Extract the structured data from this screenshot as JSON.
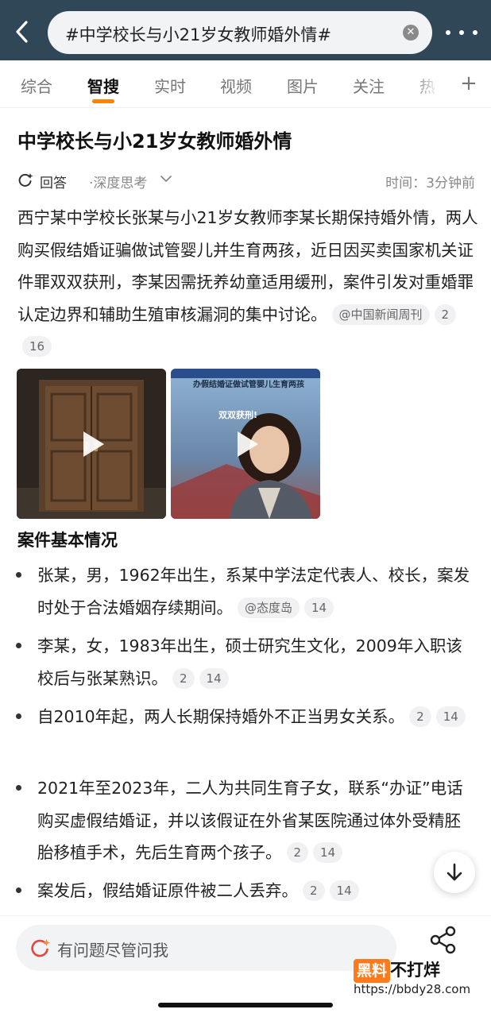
{
  "search": {
    "query": "#中学校长与小21岁女教师婚外情#",
    "clear_icon": "clear-icon",
    "back_icon": "chevron-left-icon",
    "more_icon": "more-horizontal-icon"
  },
  "tabs": [
    {
      "label": "综合",
      "active": false
    },
    {
      "label": "智搜",
      "active": true
    },
    {
      "label": "实时",
      "active": false
    },
    {
      "label": "视频",
      "active": false
    },
    {
      "label": "图片",
      "active": false
    },
    {
      "label": "关注",
      "active": false
    },
    {
      "label": "热",
      "active": false
    }
  ],
  "tab_plus": "+",
  "article": {
    "title": "中学校长与小21岁女教师婚外情",
    "answer_label": "回答",
    "deep_think_label": "·深度思考",
    "time_label": "时间：3分钟前",
    "summary": "西宁某中学校长张某与小21岁女教师李某长期保持婚外情，两人购买假结婚证骗做试管婴儿并生育两孩，近日因买卖国家机关证件罪双双获刑，李某因需抚养幼童适用缓刑，案件引发对重婚罪认定边界和辅助生殖审核漏洞的集中讨论。",
    "summary_source": "@中国新闻周刊",
    "summary_chips": [
      "2",
      "16"
    ],
    "media": [
      {
        "name": "video-door",
        "play_icon": "play-icon"
      },
      {
        "name": "video-woman",
        "overlay_text_1": "办假结婚证做试管婴儿生育两孩",
        "overlay_text_2": "双双获刑!",
        "play_icon": "play-icon"
      }
    ],
    "section_title": "案件基本情况",
    "bullets": [
      {
        "text": "张某，男，1962年出生，系某中学法定代表人、校长，案发时处于合法婚姻存续期间。",
        "source": "@态度岛",
        "chips": [
          "14"
        ]
      },
      {
        "text": "李某，女，1983年出生，硕士研究生文化，2009年入职该校后与张某熟识。",
        "source": "",
        "chips": [
          "2",
          "14"
        ]
      },
      {
        "text": "自2010年起，两人长期保持婚外不正当男女关系。",
        "source": "",
        "chips": [
          "2",
          "14"
        ]
      },
      {
        "text": "2021年至2023年，二人为共同生育子女，联系“办证”电话购买虚假结婚证，并以该假证在外省某医院通过体外受精胚胎移植手术，先后生育两个孩子。",
        "source": "",
        "chips": [
          "2",
          "14"
        ]
      },
      {
        "text": "案发后，假结婚证原件被二人丢弃。",
        "source": "",
        "chips": [
          "2",
          "14"
        ]
      }
    ]
  },
  "scroll_down_icon": "arrow-down-icon",
  "bottom": {
    "ask_placeholder": "有问题尽管问我",
    "ask_icon": "sparkle-search-icon",
    "share_icon": "share-icon"
  },
  "watermark": {
    "logo_a": "黑料",
    "logo_b": "不打烊",
    "url": "https://bbdy28.com"
  },
  "colors": {
    "topbar": "#2f4757",
    "accent": "#ff8200",
    "text": "#222222",
    "muted": "#888888"
  }
}
